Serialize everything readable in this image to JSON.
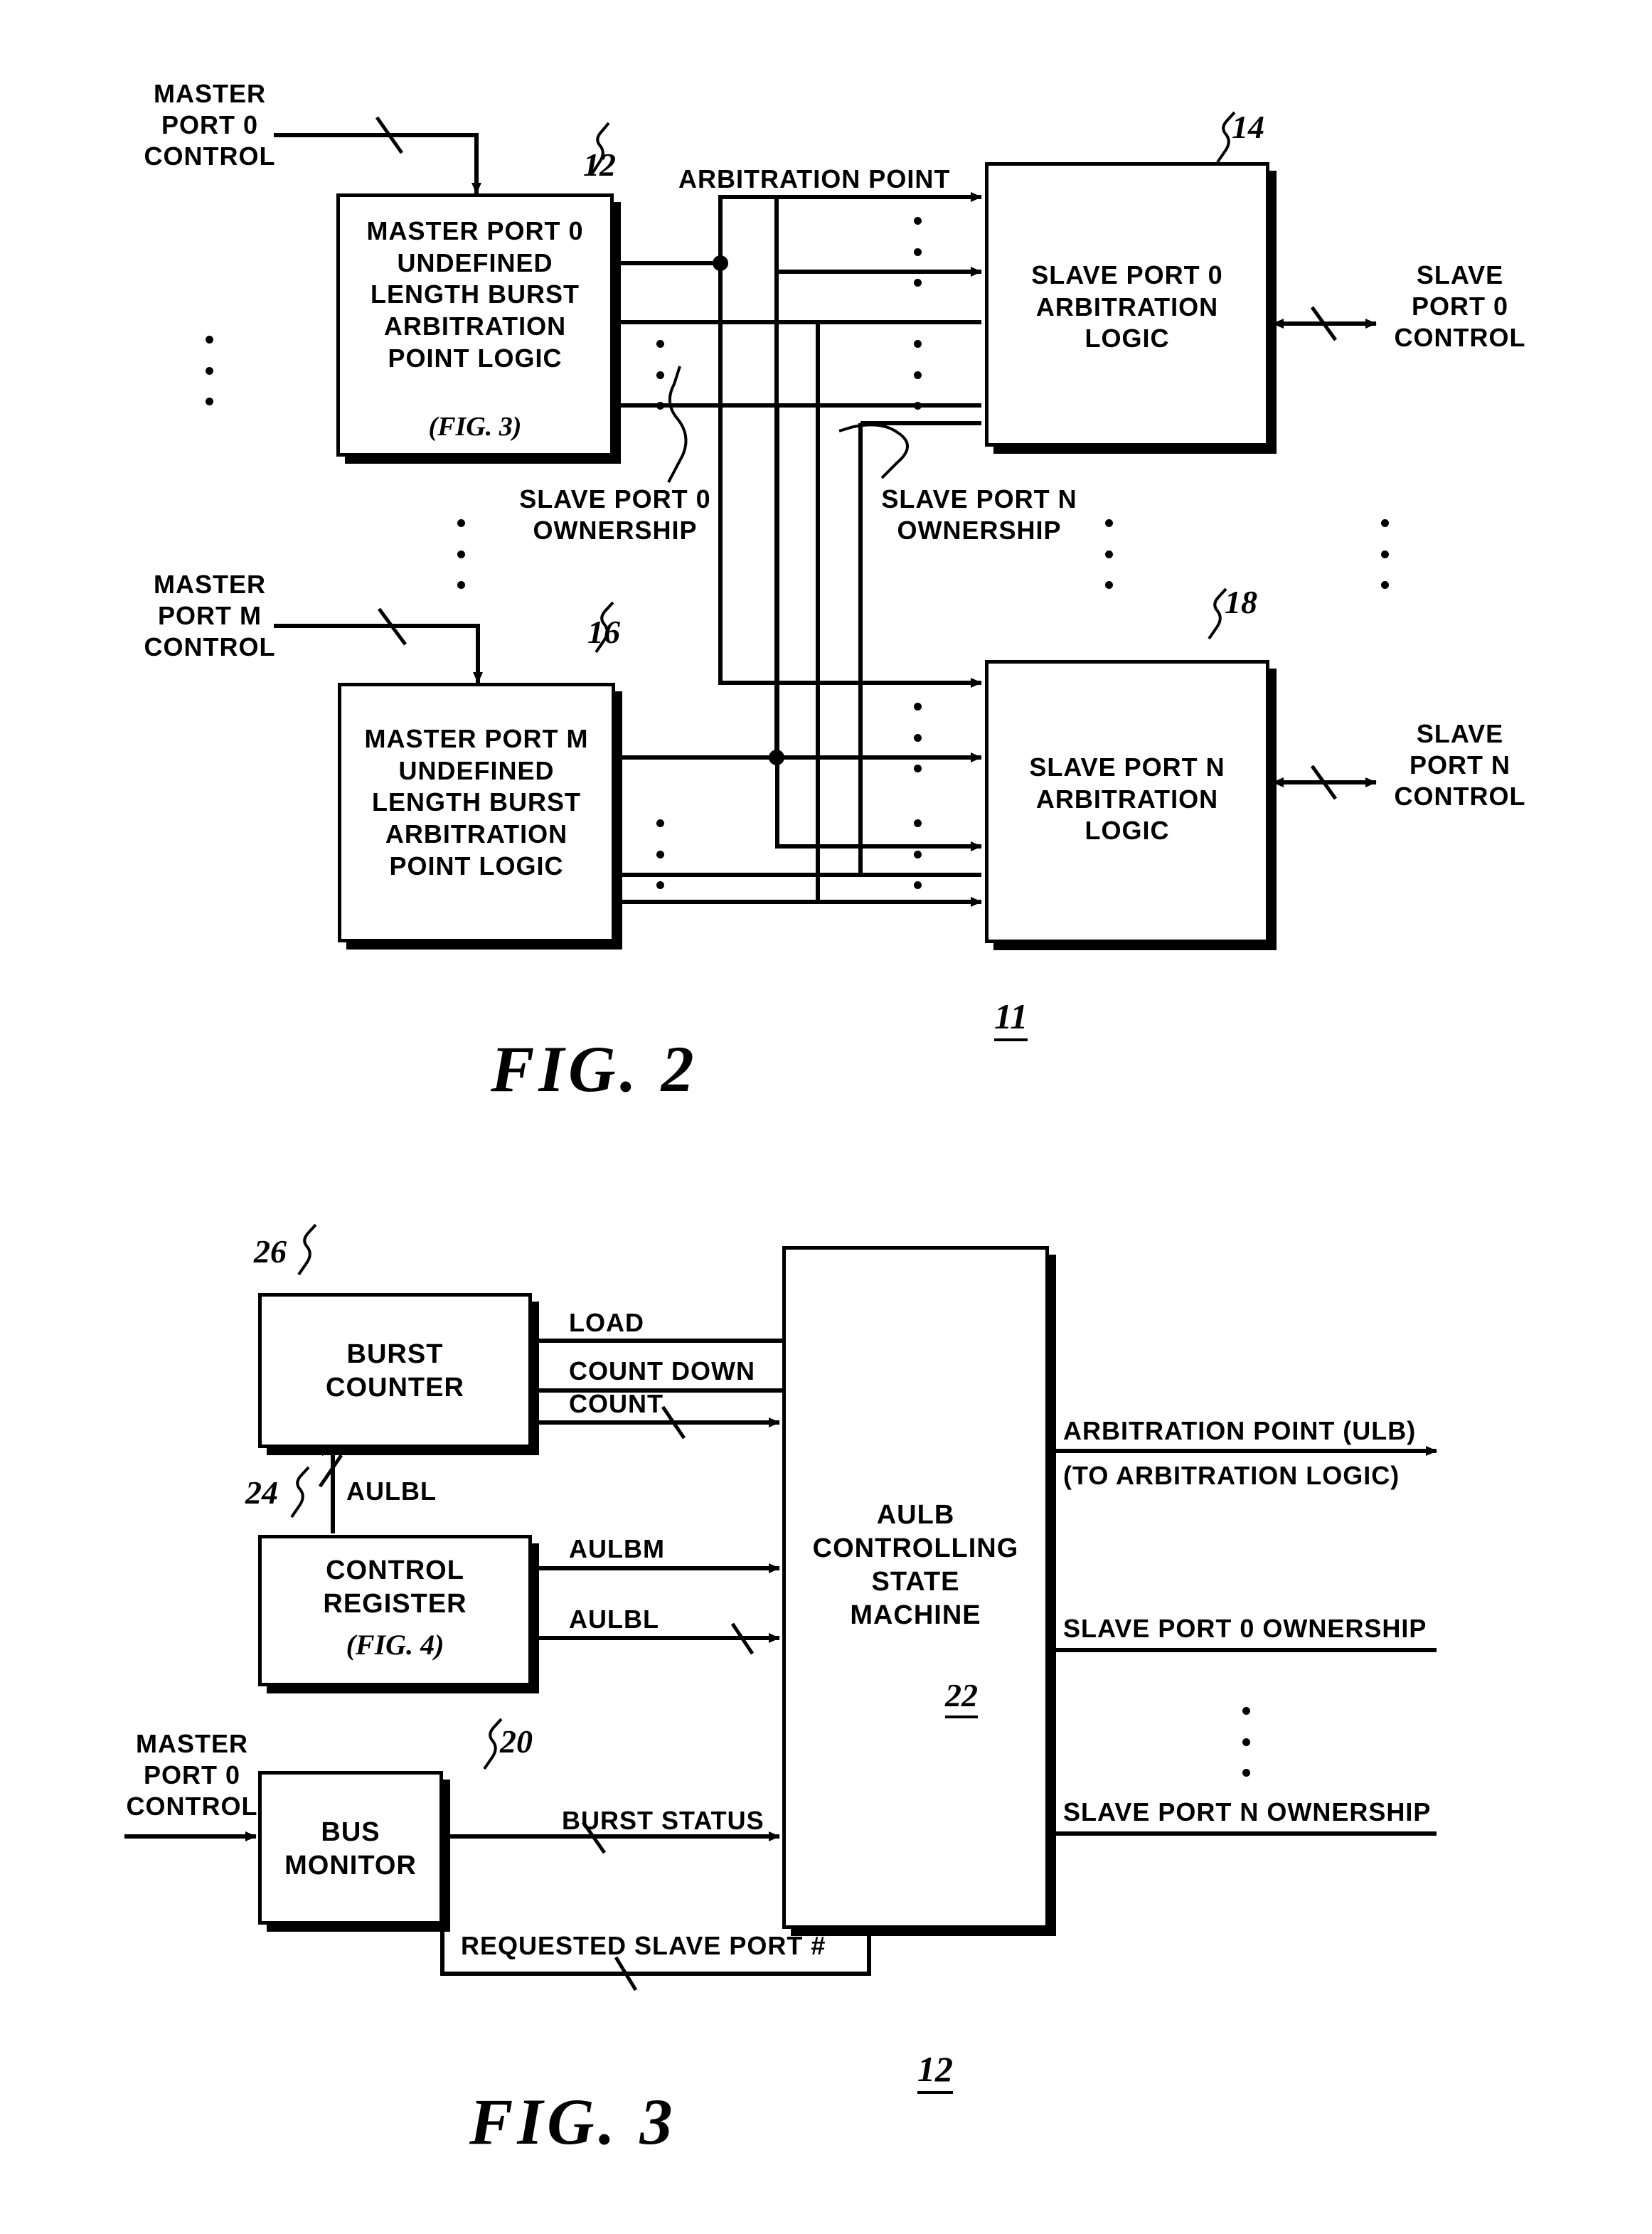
{
  "figures": [
    {
      "id": "fig2",
      "caption": "FIG. 2",
      "ref": "11",
      "blocks": [
        {
          "ref": "12",
          "lines": [
            "MASTER PORT 0",
            "UNDEFINED",
            "LENGTH BURST",
            "ARBITRATION",
            "POINT LOGIC"
          ],
          "italic_line": "(FIG. 3)"
        },
        {
          "ref": "14",
          "lines": [
            "SLAVE PORT 0",
            "ARBITRATION",
            "LOGIC"
          ],
          "italic_line": ""
        },
        {
          "ref": "16",
          "lines": [
            "MASTER PORT M",
            "UNDEFINED",
            "LENGTH BURST",
            "ARBITRATION",
            "POINT LOGIC"
          ],
          "italic_line": ""
        },
        {
          "ref": "18",
          "lines": [
            "SLAVE PORT N",
            "ARBITRATION",
            "LOGIC"
          ],
          "italic_line": ""
        }
      ],
      "labels": {
        "master_port_0_control": [
          "MASTER",
          "PORT 0",
          "CONTROL"
        ],
        "master_port_m_control": [
          "MASTER",
          "PORT M",
          "CONTROL"
        ],
        "arbitration_point": "ARBITRATION POINT",
        "slave_port_0_ownership": [
          "SLAVE PORT 0",
          "OWNERSHIP"
        ],
        "slave_port_n_ownership": [
          "SLAVE PORT N",
          "OWNERSHIP"
        ],
        "slave_port_0_control": [
          "SLAVE",
          "PORT 0",
          "CONTROL"
        ],
        "slave_port_n_control": [
          "SLAVE",
          "PORT N",
          "CONTROL"
        ]
      }
    },
    {
      "id": "fig3",
      "caption": "FIG. 3",
      "ref": "12",
      "blocks": [
        {
          "ref": "26",
          "lines": [
            "BURST",
            "COUNTER"
          ],
          "italic_line": ""
        },
        {
          "ref": "24",
          "lines": [
            "CONTROL",
            "REGISTER"
          ],
          "italic_line": "(FIG. 4)"
        },
        {
          "ref": "20",
          "lines": [
            "BUS",
            "MONITOR"
          ],
          "italic_line": ""
        },
        {
          "ref": "22",
          "lines": [
            "AULB",
            "CONTROLLING",
            "STATE",
            "MACHINE"
          ],
          "italic_line": ""
        }
      ],
      "labels": {
        "load": "LOAD",
        "count_down": "COUNT DOWN",
        "count": "COUNT",
        "aulbl_vertical": "AULBL",
        "aulbm": "AULBM",
        "aulbl": "AULBL",
        "burst_status": "BURST STATUS",
        "requested_slave_port": "REQUESTED SLAVE PORT #",
        "master_port_0_control": [
          "MASTER",
          "PORT 0",
          "CONTROL"
        ],
        "arbitration_point_ulb": "ARBITRATION POINT (ULB)",
        "to_arbitration_logic": "(TO ARBITRATION LOGIC)",
        "slave_port_0_ownership": "SLAVE PORT 0 OWNERSHIP",
        "slave_port_n_ownership": "SLAVE PORT N OWNERSHIP"
      }
    }
  ],
  "colors": {
    "ink": "#000000",
    "paper": "#ffffff"
  }
}
